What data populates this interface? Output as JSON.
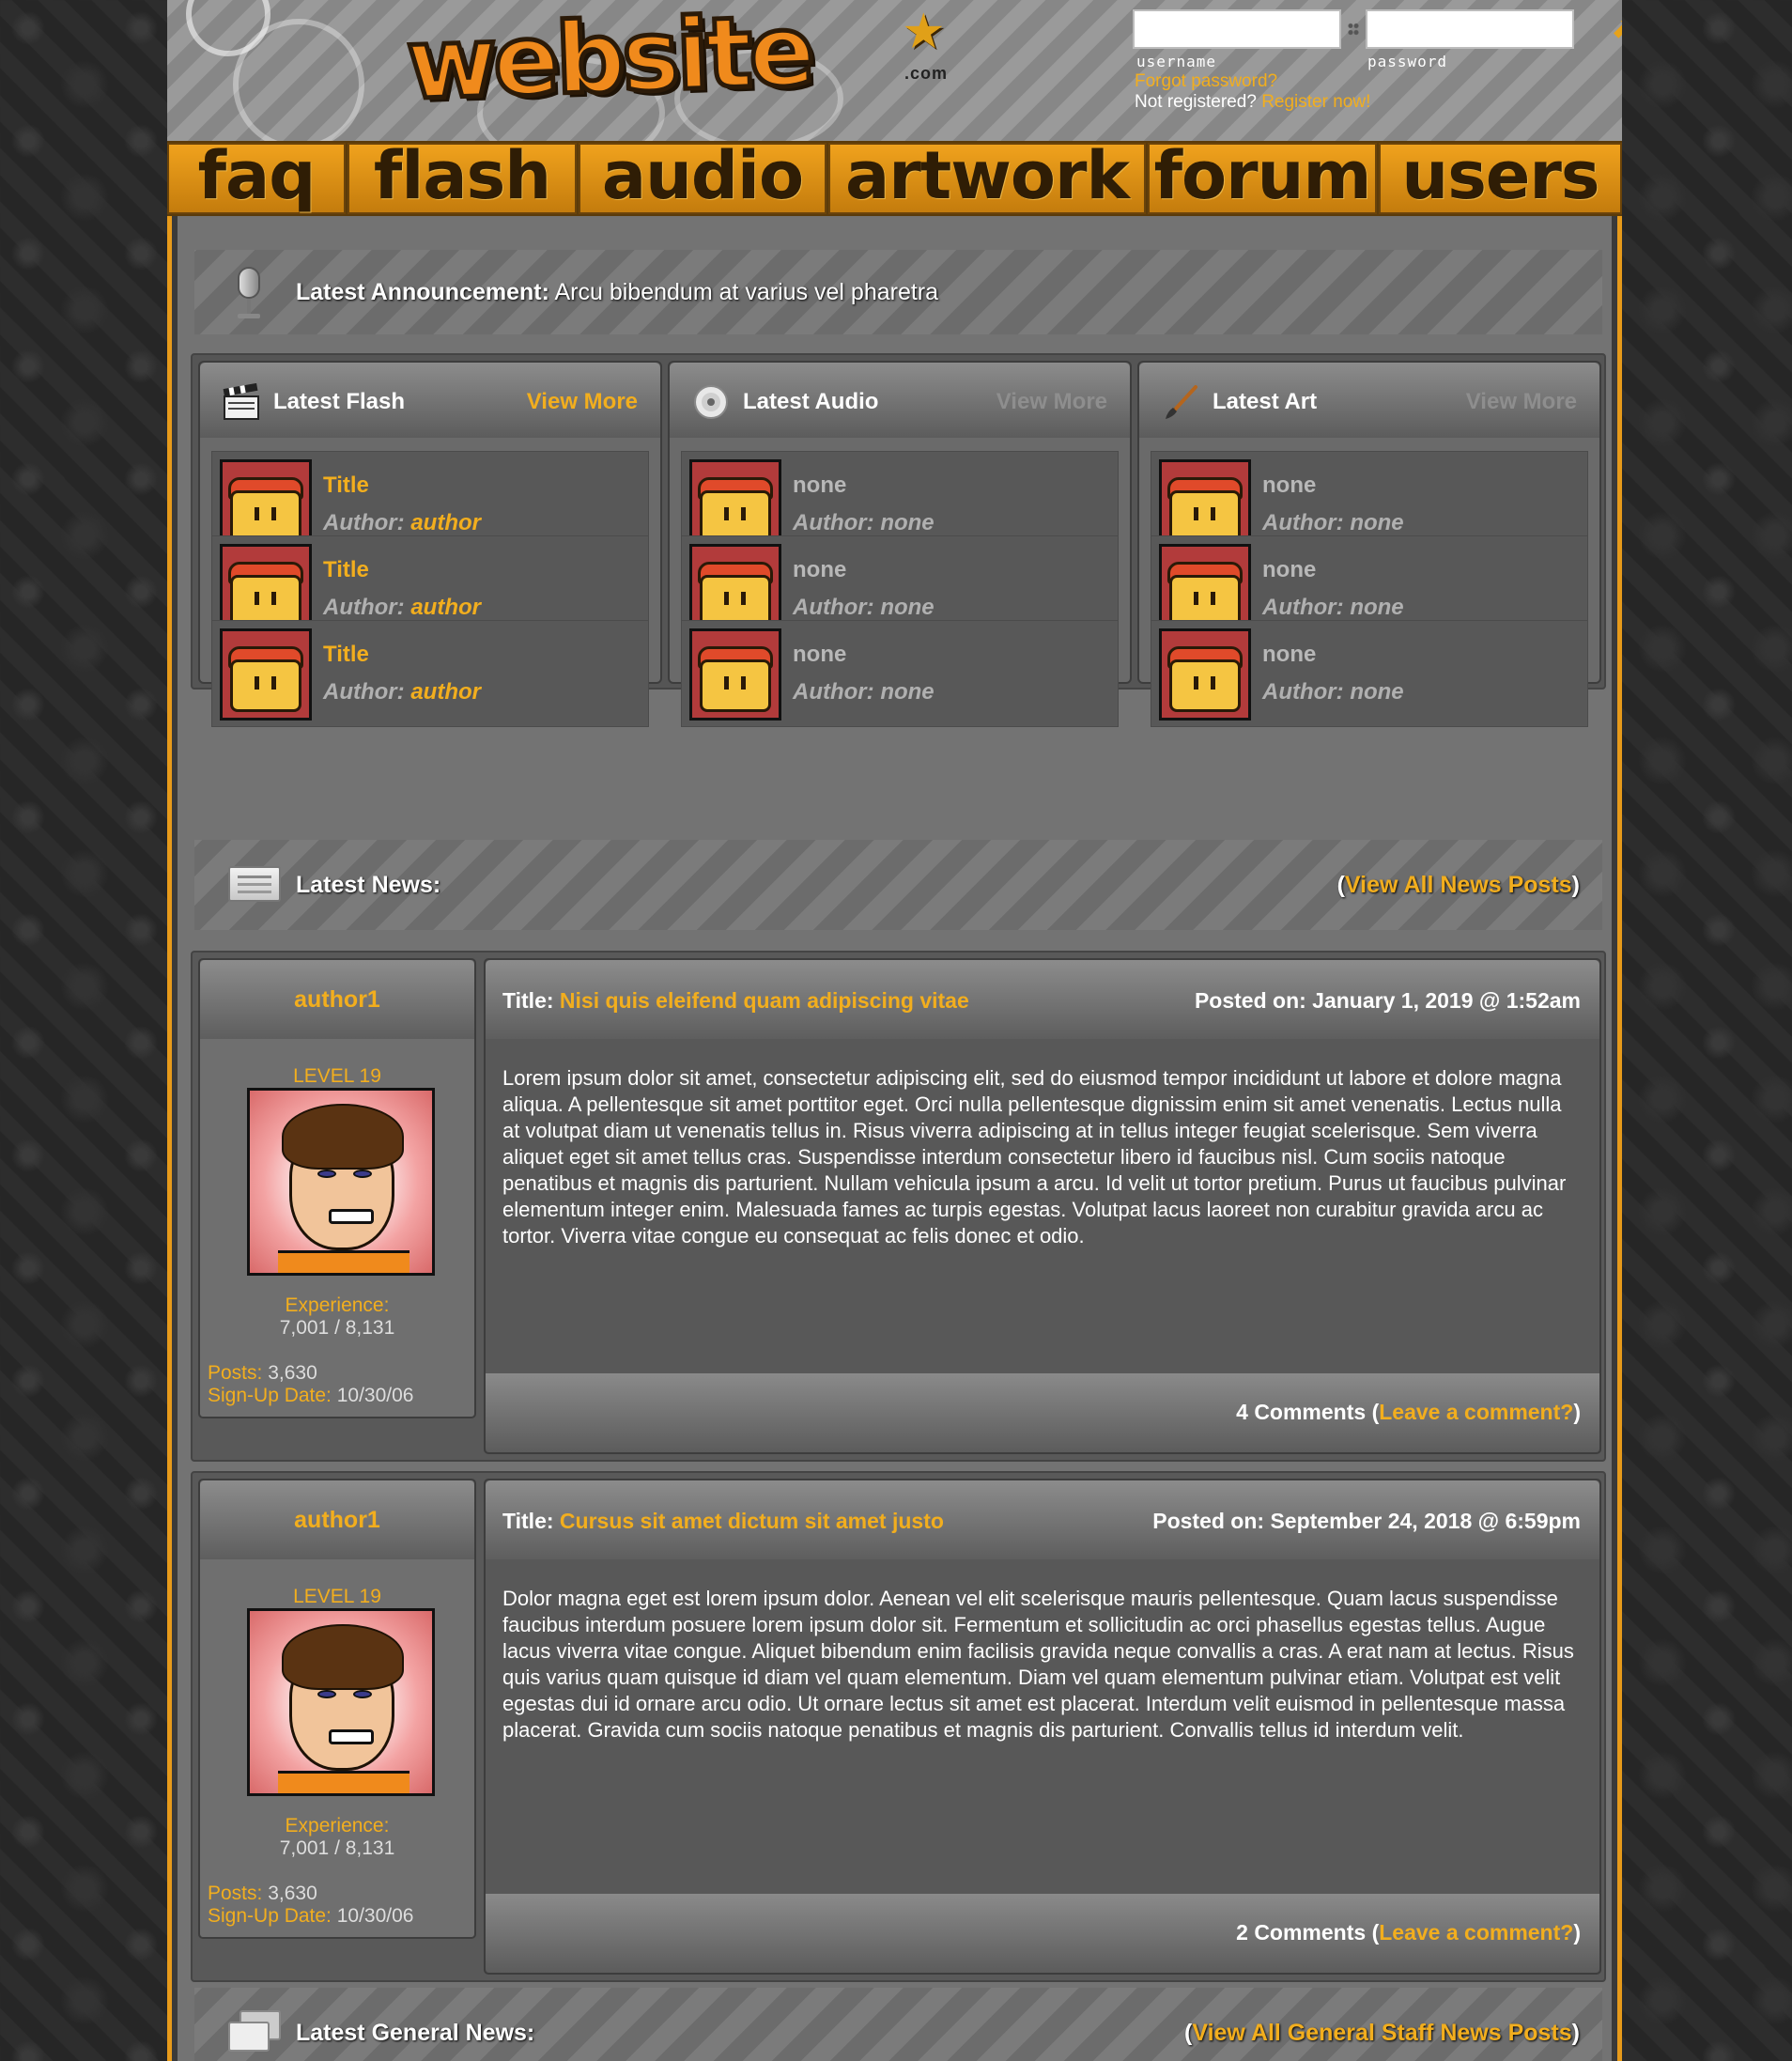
{
  "header": {
    "logo_text": "website",
    "logo_suffix": ".com",
    "login": {
      "username_caption": "username",
      "password_caption": "password",
      "forgot_label": "Forgot password?",
      "not_registered_text": "Not registered?",
      "register_label": "Register now!",
      "go_icon": "arrow-icon"
    }
  },
  "nav": {
    "tabs": [
      "faq",
      "flash",
      "audio",
      "artwork",
      "forum",
      "users"
    ]
  },
  "announcement": {
    "label": "Latest Announcement:",
    "text": " Arcu bibendum at varius vel pharetra"
  },
  "latest": [
    {
      "title": "Latest Flash",
      "more": "View More",
      "icon": "clapperboard-icon",
      "items": [
        {
          "title": "Title",
          "author_label": "Author: ",
          "author": "author"
        },
        {
          "title": "Title",
          "author_label": "Author: ",
          "author": "author"
        },
        {
          "title": "Title",
          "author_label": "Author: ",
          "author": "author"
        }
      ]
    },
    {
      "title": "Latest Audio",
      "more": "View More",
      "icon": "cd-icon",
      "items": [
        {
          "title": "none",
          "author_label": "Author: ",
          "author": "none"
        },
        {
          "title": "none",
          "author_label": "Author: ",
          "author": "none"
        },
        {
          "title": "none",
          "author_label": "Author: ",
          "author": "none"
        }
      ]
    },
    {
      "title": "Latest Art",
      "more": "View More",
      "icon": "paintbrush-icon",
      "items": [
        {
          "title": "none",
          "author_label": "Author: ",
          "author": "none"
        },
        {
          "title": "none",
          "author_label": "Author: ",
          "author": "none"
        },
        {
          "title": "none",
          "author_label": "Author: ",
          "author": "none"
        }
      ]
    }
  ],
  "news": {
    "label": "Latest News:",
    "open_paren": "(",
    "link": "View All News Posts",
    "close_paren": ")"
  },
  "posts": [
    {
      "author": "author1",
      "level": "LEVEL 19",
      "exp_label": "Experience:",
      "exp_value": "7,001 / 8,131",
      "posts_label": "Posts:",
      "posts_value": " 3,630",
      "signup_label": "Sign-Up Date:",
      "signup_value": " 10/30/06",
      "title_label": "Title: ",
      "title": "Nisi quis eleifend quam adipiscing vitae",
      "posted": "Posted on: January 1, 2019 @ 1:52am",
      "body": "Lorem ipsum dolor sit amet, consectetur adipiscing elit, sed do eiusmod tempor incididunt ut labore et dolore magna aliqua. A pellentesque sit amet porttitor eget. Orci nulla pellentesque dignissim enim sit amet venenatis. Lectus nulla at volutpat diam ut venenatis tellus in. Risus viverra adipiscing at in tellus integer feugiat scelerisque. Sem viverra aliquet eget sit amet tellus cras. Suspendisse interdum consectetur libero id faucibus nisl. Cum sociis natoque penatibus et magnis dis parturient. Nullam vehicula ipsum a arcu. Id velit ut tortor pretium. Purus ut faucibus pulvinar elementum integer enim. Malesuada fames ac turpis egestas. Volutpat lacus laoreet non curabitur gravida arcu ac tortor. Viverra vitae congue eu consequat ac felis donec et odio.",
      "comments": "4 Comments (",
      "leave": "Leave a comment?",
      "close_paren": ")"
    },
    {
      "author": "author1",
      "level": "LEVEL 19",
      "exp_label": "Experience:",
      "exp_value": "7,001 / 8,131",
      "posts_label": "Posts:",
      "posts_value": " 3,630",
      "signup_label": "Sign-Up Date:",
      "signup_value": " 10/30/06",
      "title_label": "Title: ",
      "title": "Cursus sit amet dictum sit amet justo",
      "posted": "Posted on: September 24, 2018 @ 6:59pm",
      "body": "Dolor magna eget est lorem ipsum dolor. Aenean vel elit scelerisque mauris pellentesque. Quam lacus suspendisse faucibus interdum posuere lorem ipsum dolor sit. Fermentum et sollicitudin ac orci phasellus egestas tellus. Augue lacus viverra vitae congue. Aliquet bibendum enim facilisis gravida neque convallis a cras. A erat nam at lectus. Risus quis varius quam quisque id diam vel quam elementum. Diam vel quam elementum pulvinar etiam. Volutpat est velit egestas dui id ornare arcu odio. Ut ornare lectus sit amet est placerat. Interdum velit euismod in pellentesque massa placerat. Gravida cum sociis natoque penatibus et magnis dis parturient. Convallis tellus id interdum velit.",
      "comments": "2 Comments (",
      "leave": "Leave a comment?",
      "close_paren": ")"
    }
  ],
  "general_news": {
    "label": "Latest General News:",
    "open_paren": "(",
    "link": "View All General Staff News Posts",
    "close_paren": ")"
  },
  "colors": {
    "accent": "#f2ae1e",
    "nav_tab": "#e79a1a",
    "panel": "#737373"
  }
}
